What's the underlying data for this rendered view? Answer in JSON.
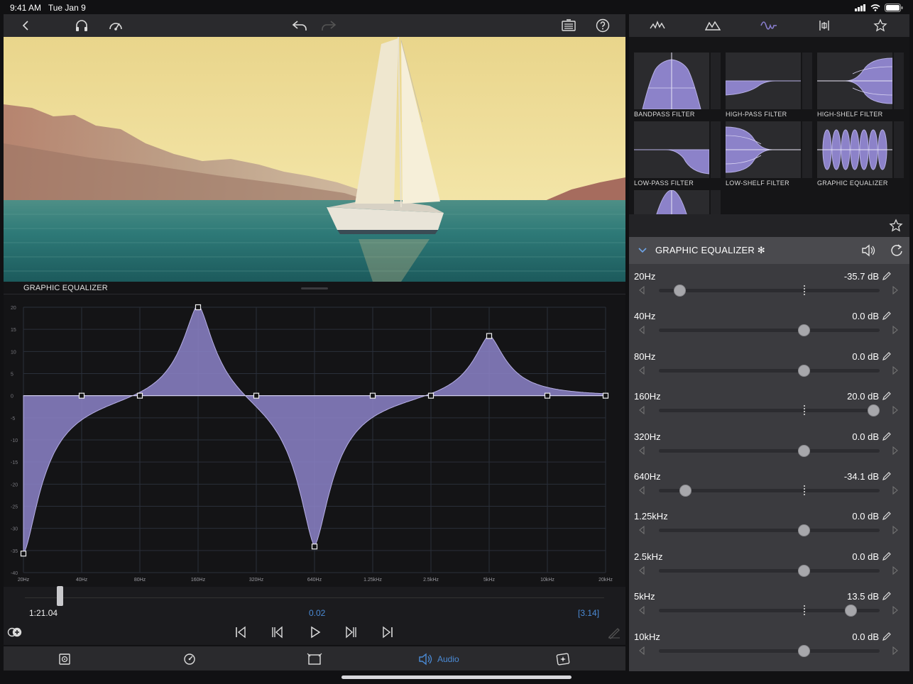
{
  "status": {
    "time": "9:41 AM",
    "date": "Tue Jan 9"
  },
  "colors": {
    "accent": "#8a7fd0",
    "accent_fill": "#8c82c9",
    "link_blue": "#4b8bd6"
  },
  "toolbar": {
    "icons": [
      "back-chevron-icon",
      "headphones-icon",
      "speed-gauge-icon",
      "undo-icon",
      "redo-icon",
      "inspector-icon",
      "help-icon"
    ]
  },
  "eq_graph": {
    "title": "GRAPHIC EQUALIZER",
    "y_ticks": [
      "20",
      "15",
      "10",
      "5",
      "0",
      "-5",
      "-10",
      "-15",
      "-20",
      "-25",
      "-30",
      "-35",
      "-40"
    ],
    "x_ticks": [
      "20Hz",
      "40Hz",
      "80Hz",
      "160Hz",
      "320Hz",
      "640Hz",
      "1.25kHz",
      "2.5kHz",
      "5kHz",
      "10kHz",
      "20kHz"
    ]
  },
  "chart_data": {
    "type": "area",
    "title": "GRAPHIC EQUALIZER",
    "xlabel": "",
    "ylabel": "",
    "categories": [
      "20Hz",
      "40Hz",
      "80Hz",
      "160Hz",
      "320Hz",
      "640Hz",
      "1.25kHz",
      "2.5kHz",
      "5kHz",
      "10kHz",
      "20kHz"
    ],
    "ylim": [
      -40,
      20
    ],
    "series": [
      {
        "values": [
          -35.7,
          0,
          0,
          20,
          0,
          -34.1,
          0,
          0,
          13.5,
          0,
          0
        ]
      }
    ],
    "grid": true
  },
  "timeline": {
    "current_time": "1:21.04",
    "selection": "0.02",
    "duration": "[3.14]",
    "playhead_progress": 0.06
  },
  "bottom_bar": {
    "audio_label": "Audio"
  },
  "right_panel": {
    "tabs": [
      "waveform-icon",
      "peaks-icon",
      "eq-curve-icon",
      "compressor-icon",
      "star-icon"
    ],
    "presets": [
      {
        "label": "BANDPASS FILTER"
      },
      {
        "label": "HIGH-PASS FILTER"
      },
      {
        "label": "HIGH-SHELF FILTER"
      },
      {
        "label": "LOW-PASS FILTER"
      },
      {
        "label": "LOW-SHELF FILTER"
      },
      {
        "label": "GRAPHIC EQUALIZER"
      }
    ],
    "effect": {
      "title": "GRAPHIC EQUALIZER ✻"
    },
    "bands": [
      {
        "freq": "20Hz",
        "db": "-35.7 dB",
        "value": -35.7
      },
      {
        "freq": "40Hz",
        "db": "0.0 dB",
        "value": 0.0
      },
      {
        "freq": "80Hz",
        "db": "0.0 dB",
        "value": 0.0
      },
      {
        "freq": "160Hz",
        "db": "20.0 dB",
        "value": 20.0
      },
      {
        "freq": "320Hz",
        "db": "0.0 dB",
        "value": 0.0
      },
      {
        "freq": "640Hz",
        "db": "-34.1 dB",
        "value": -34.1
      },
      {
        "freq": "1.25kHz",
        "db": "0.0 dB",
        "value": 0.0
      },
      {
        "freq": "2.5kHz",
        "db": "0.0 dB",
        "value": 0.0
      },
      {
        "freq": "5kHz",
        "db": "13.5 dB",
        "value": 13.5
      },
      {
        "freq": "10kHz",
        "db": "0.0 dB",
        "value": 0.0
      }
    ]
  }
}
